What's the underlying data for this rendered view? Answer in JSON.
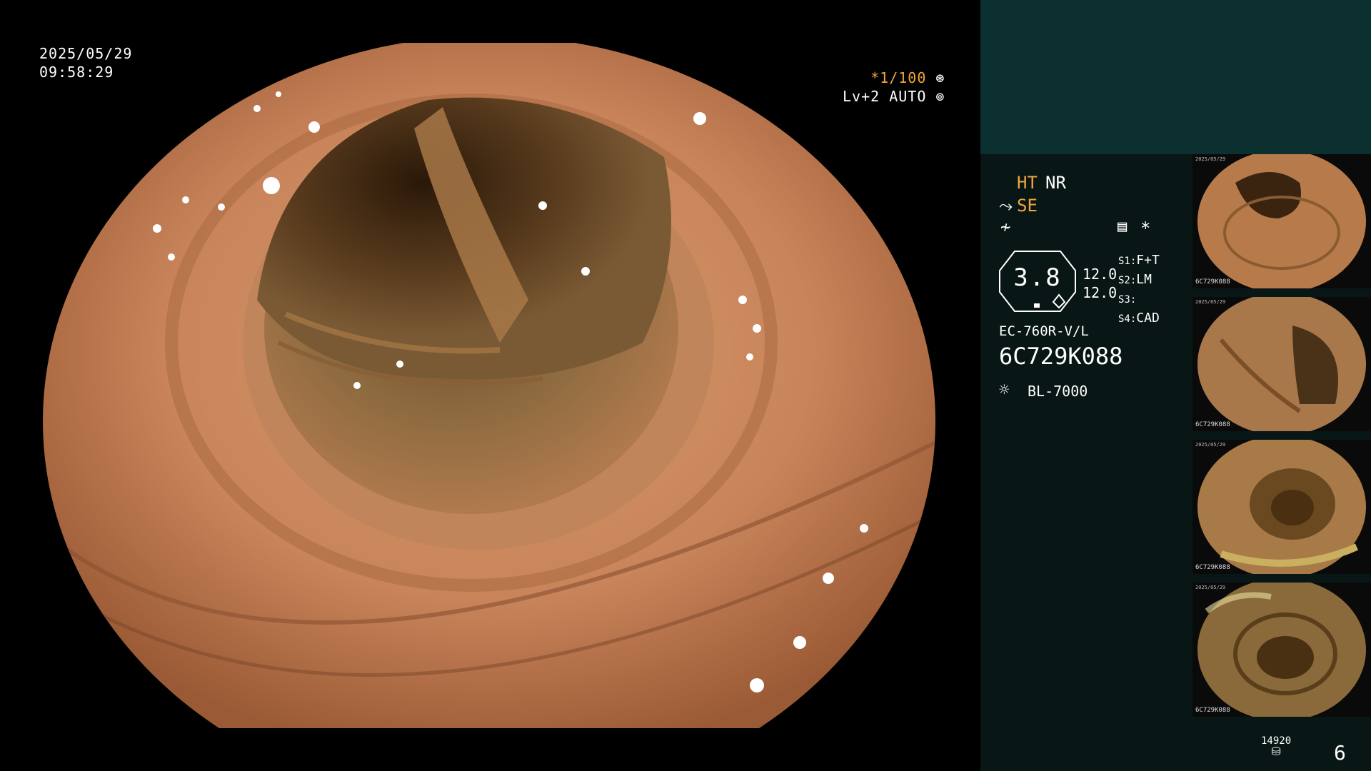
{
  "overlay": {
    "date": "2025/05/29",
    "time": "09:58:29",
    "shutter": "*1/100",
    "level": "Lv+2 AUTO"
  },
  "panel": {
    "ht": "HT",
    "nr": "NR",
    "se": "SE",
    "badge_value": "3.8",
    "val_a": "12.0",
    "val_b": "12.0",
    "switches": [
      {
        "key": "S1:",
        "value": "F+T"
      },
      {
        "key": "S2:",
        "value": "LM"
      },
      {
        "key": "S3:",
        "value": ""
      },
      {
        "key": "S4:",
        "value": "CAD"
      }
    ],
    "scope_model": "EC-760R-V/L",
    "serial": "6C729K088",
    "light_source": "BL-7000",
    "star": "*"
  },
  "thumbnails": [
    {
      "caption": "6C729K088",
      "date": "2025/05/29"
    },
    {
      "caption": "6C729K088",
      "date": "2025/05/29"
    },
    {
      "caption": "6C729K088",
      "date": "2025/05/29"
    },
    {
      "caption": "6C729K088",
      "date": "2025/05/29"
    }
  ],
  "footer": {
    "counter": "14920",
    "page": "6"
  },
  "colors": {
    "panel_top": "#0c3030",
    "panel": "#081616",
    "accent_orange": "#f0a63a"
  }
}
